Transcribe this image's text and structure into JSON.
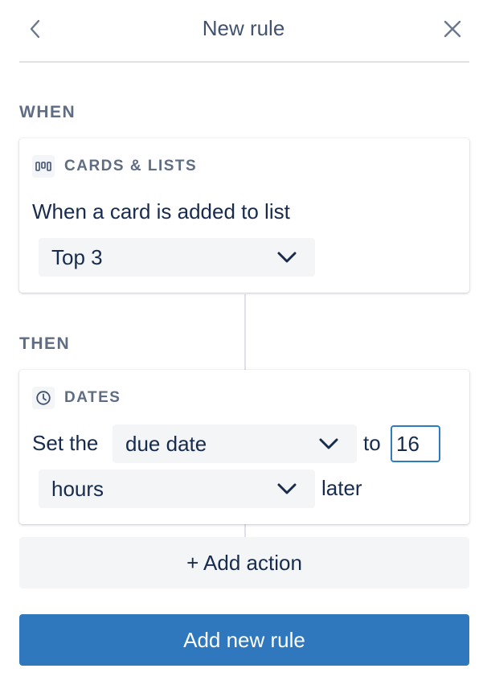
{
  "header": {
    "title": "New rule",
    "back_icon": "chevron-left-icon",
    "close_icon": "close-icon"
  },
  "when": {
    "label": "WHEN",
    "card": {
      "icon": "lists-icon",
      "title": "CARDS & LISTS",
      "trigger_text": "When a card is added to list",
      "list_select": {
        "value": "Top 3"
      }
    }
  },
  "then": {
    "label": "THEN",
    "card": {
      "icon": "clock-icon",
      "title": "DATES",
      "prefix": "Set the",
      "field_select": {
        "value": "due date"
      },
      "to_text": "to",
      "amount_input": {
        "value": "16"
      },
      "unit_select": {
        "value": "hours"
      },
      "suffix": "later"
    }
  },
  "actions": {
    "add_action_label": "+ Add action",
    "add_rule_label": "Add new rule"
  },
  "colors": {
    "primary": "#2f78bd",
    "focus_border": "#2f7bbf",
    "text": "#172b4d",
    "muted": "#5e6c84",
    "subtle_bg": "#f4f5f7"
  }
}
